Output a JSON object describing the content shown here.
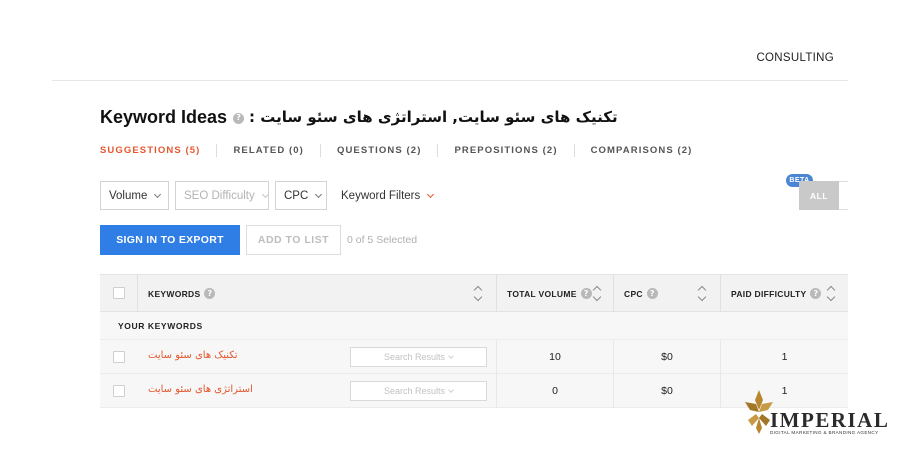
{
  "nav": {
    "consulting": "CONSULTING"
  },
  "title": {
    "main": "Keyword Ideas",
    "help": "?",
    "query": "تکنیک های سئو سایت, استراتژی های سئو سایت :"
  },
  "tabs": [
    {
      "label": "SUGGESTIONS (5)",
      "active": true
    },
    {
      "label": "RELATED (0)"
    },
    {
      "label": "QUESTIONS (2)"
    },
    {
      "label": "PREPOSITIONS (2)"
    },
    {
      "label": "COMPARISONS (2)"
    }
  ],
  "filters": {
    "volume": "Volume",
    "seo_difficulty": "SEO Difficulty",
    "cpc": "CPC",
    "keyword_filters": "Keyword Filters",
    "beta": "BETA",
    "all": "ALL"
  },
  "actions": {
    "export": "SIGN IN TO EXPORT",
    "add_to_list": "ADD TO LIST",
    "selected": "0 of 5 Selected"
  },
  "table": {
    "headers": {
      "keywords": "KEYWORDS",
      "total_volume": "TOTAL VOLUME",
      "cpc": "CPC",
      "paid_difficulty": "PAID DIFFICULTY"
    },
    "group_label": "YOUR KEYWORDS",
    "serp_label": "Search Results",
    "rows": [
      {
        "keyword": "تکنیک های سئو سایت",
        "volume": "10",
        "cpc": "$0",
        "paid_difficulty": "1"
      },
      {
        "keyword": "استراتژی های سئو سایت",
        "volume": "0",
        "cpc": "$0",
        "paid_difficulty": "1"
      }
    ]
  },
  "logo": {
    "name": "IMPERIAL",
    "tagline": "DIGITAL MARKETING & BRANDING AGENCY"
  },
  "colors": {
    "accent": "#e4572e",
    "primary_button": "#2f7ee6",
    "beta_badge": "#4a86d4",
    "logo_gold": "#b8862f"
  }
}
